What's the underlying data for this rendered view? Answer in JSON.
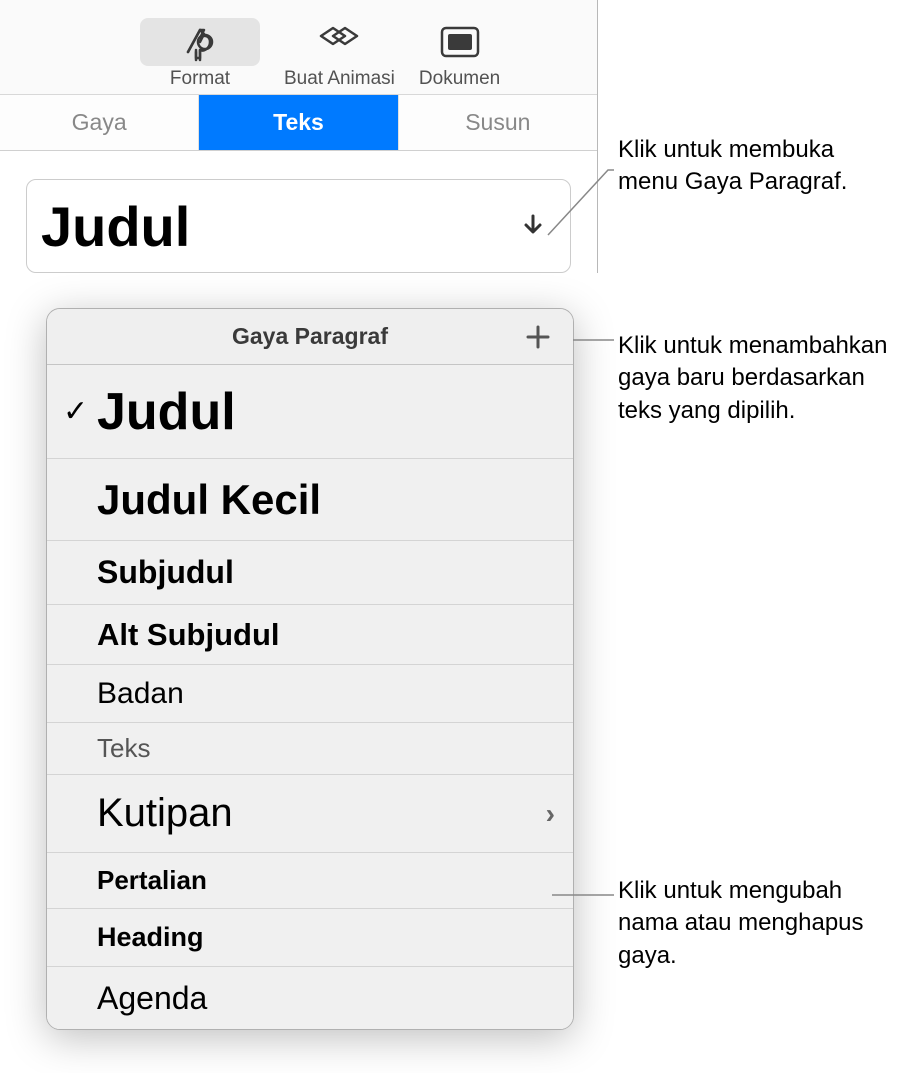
{
  "toolbar": {
    "format": "Format",
    "animate": "Buat Animasi",
    "document": "Dokumen"
  },
  "tabs": {
    "style": "Gaya",
    "text": "Teks",
    "arrange": "Susun"
  },
  "currentStyle": "Judul",
  "popover": {
    "title": "Gaya Paragraf"
  },
  "styles": [
    {
      "label": "Judul",
      "selected": true,
      "cls": "s-judul"
    },
    {
      "label": "Judul Kecil",
      "selected": false,
      "cls": "s-judulkecil"
    },
    {
      "label": "Subjudul",
      "selected": false,
      "cls": "s-subjudul"
    },
    {
      "label": "Alt Subjudul",
      "selected": false,
      "cls": "s-altsubjudul"
    },
    {
      "label": "Badan",
      "selected": false,
      "cls": "s-badan"
    },
    {
      "label": "Teks",
      "selected": false,
      "cls": "s-teks"
    },
    {
      "label": "Kutipan",
      "selected": false,
      "cls": "s-kutipan",
      "hasChevron": true
    },
    {
      "label": "Pertalian",
      "selected": false,
      "cls": "s-pertalian"
    },
    {
      "label": "Heading",
      "selected": false,
      "cls": "s-heading"
    },
    {
      "label": "Agenda",
      "selected": false,
      "cls": "s-agenda"
    }
  ],
  "callouts": {
    "openMenu": "Klik untuk membuka menu Gaya Paragraf.",
    "addStyle": "Klik untuk menambahkan gaya baru berdasarkan teks yang dipilih.",
    "renameDelete": "Klik untuk mengubah nama atau menghapus gaya."
  }
}
